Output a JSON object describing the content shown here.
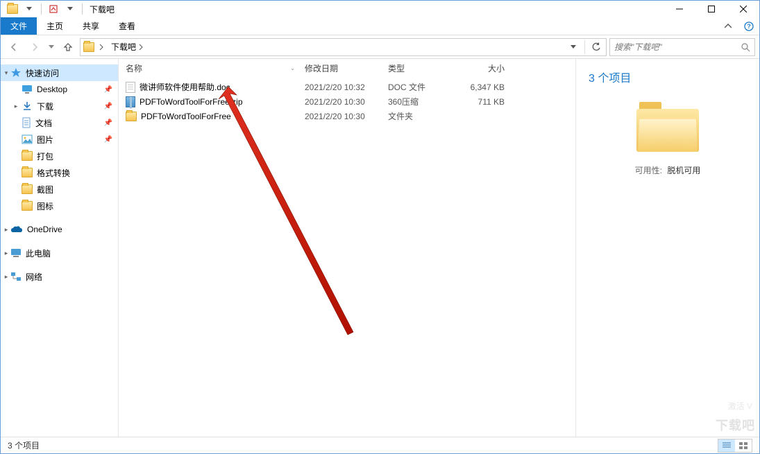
{
  "window": {
    "title": "下载吧"
  },
  "ribbon": {
    "file": "文件",
    "home": "主页",
    "share": "共享",
    "view": "查看"
  },
  "breadcrumb": {
    "seg1": "下载吧"
  },
  "search": {
    "placeholder": "搜索\"下载吧\""
  },
  "sidebar": {
    "quick_access": "快速访问",
    "items": [
      {
        "label": "Desktop",
        "icon": "desktop"
      },
      {
        "label": "下载",
        "icon": "download"
      },
      {
        "label": "文档",
        "icon": "document"
      },
      {
        "label": "图片",
        "icon": "picture"
      },
      {
        "label": "打包",
        "icon": "folder"
      },
      {
        "label": "格式转换",
        "icon": "folder"
      },
      {
        "label": "截图",
        "icon": "folder"
      },
      {
        "label": "图标",
        "icon": "folder"
      }
    ],
    "onedrive": "OneDrive",
    "thispc": "此电脑",
    "network": "网络"
  },
  "columns": {
    "name": "名称",
    "date": "修改日期",
    "type": "类型",
    "size": "大小"
  },
  "rows": [
    {
      "name": "微讲师软件使用帮助.doc",
      "date": "2021/2/20 10:32",
      "type": "DOC 文件",
      "size": "6,347 KB",
      "icon": "doc"
    },
    {
      "name": "PDFToWordToolForFree.zip",
      "date": "2021/2/20 10:30",
      "type": "360压缩",
      "size": "711 KB",
      "icon": "zip"
    },
    {
      "name": "PDFToWordToolForFree",
      "date": "2021/2/20 10:30",
      "type": "文件夹",
      "size": "",
      "icon": "folder"
    }
  ],
  "details": {
    "title": "3 个项目",
    "avail_label": "可用性:",
    "avail_value": "脱机可用"
  },
  "status": {
    "text": "3 个项目"
  },
  "watermark": {
    "t1": "下载吧",
    "t2": "激活 V"
  }
}
